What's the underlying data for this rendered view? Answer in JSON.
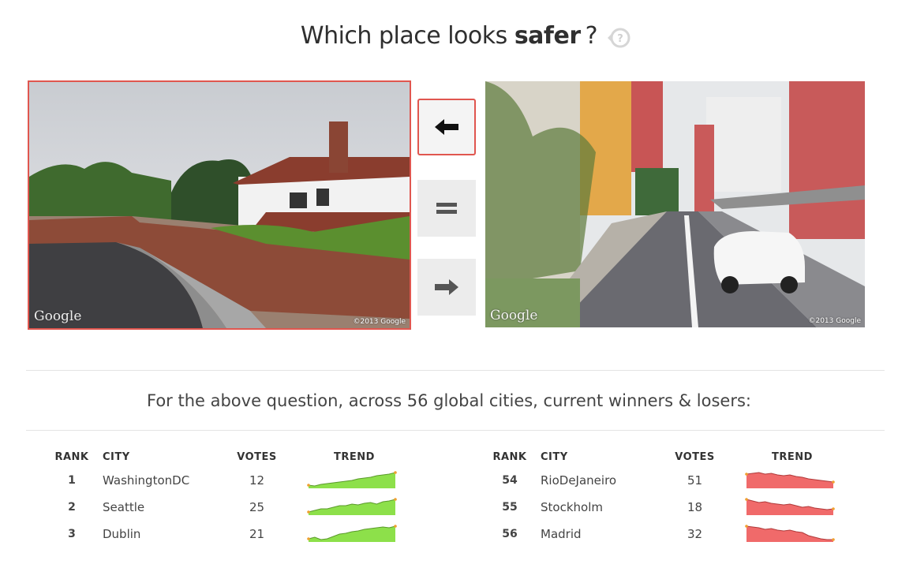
{
  "question": {
    "prefix": "Which place looks",
    "emphasis": "safer",
    "suffix": "?"
  },
  "icons": {
    "help": "help-refresh-icon",
    "left": "arrow-left-icon",
    "equal": "equals-icon",
    "right": "arrow-right-icon"
  },
  "photos": {
    "left": {
      "watermark": "Google",
      "copyright": "©2013 Google"
    },
    "right": {
      "watermark": "Google",
      "copyright": "©2013 Google"
    }
  },
  "summary_text": "For the above question, across 56 global cities, current winners & losers:",
  "leaderboard": {
    "headers": {
      "rank": "RANK",
      "city": "CITY",
      "votes": "VOTES",
      "trend": "TREND"
    },
    "winners": [
      {
        "rank": "1",
        "city": "WashingtonDC",
        "votes": "12",
        "trend": [
          2,
          1.5,
          2.5,
          3,
          3.5,
          4,
          4.5,
          5,
          6,
          6.5,
          7,
          8,
          8.5,
          9,
          10
        ]
      },
      {
        "rank": "2",
        "city": "Seattle",
        "votes": "25",
        "trend": [
          2,
          3,
          4,
          4,
          5,
          6,
          6,
          7,
          6.5,
          7.5,
          8,
          7,
          8.5,
          9,
          10
        ]
      },
      {
        "rank": "3",
        "city": "Dublin",
        "votes": "21",
        "trend": [
          2,
          3,
          1.5,
          2,
          3.5,
          5,
          5.5,
          6.5,
          7,
          8,
          8.5,
          9,
          9.5,
          9,
          10
        ]
      }
    ],
    "losers": [
      {
        "rank": "54",
        "city": "RioDeJaneiro",
        "votes": "51",
        "trend": [
          9,
          9.5,
          10,
          9,
          9.5,
          8.5,
          8,
          8.5,
          7.5,
          7,
          6,
          5.5,
          5,
          4.5,
          4
        ]
      },
      {
        "rank": "55",
        "city": "Stockholm",
        "votes": "18",
        "trend": [
          10,
          9,
          8,
          8.5,
          7.5,
          7,
          6.5,
          7,
          6,
          5,
          5.5,
          4.5,
          4,
          3.5,
          4
        ]
      },
      {
        "rank": "56",
        "city": "Madrid",
        "votes": "32",
        "trend": [
          10,
          9.5,
          9,
          8,
          8.5,
          7.5,
          7,
          7.5,
          6.5,
          6,
          4,
          3,
          2,
          1.5,
          1.5
        ]
      }
    ]
  },
  "colors": {
    "accent": "#e0564f",
    "winner_fill": "#8de04a",
    "winner_line": "#5a9a2a",
    "loser_fill": "#f06a6a",
    "loser_line": "#b03a3a",
    "endpoint": "#f0a030"
  }
}
